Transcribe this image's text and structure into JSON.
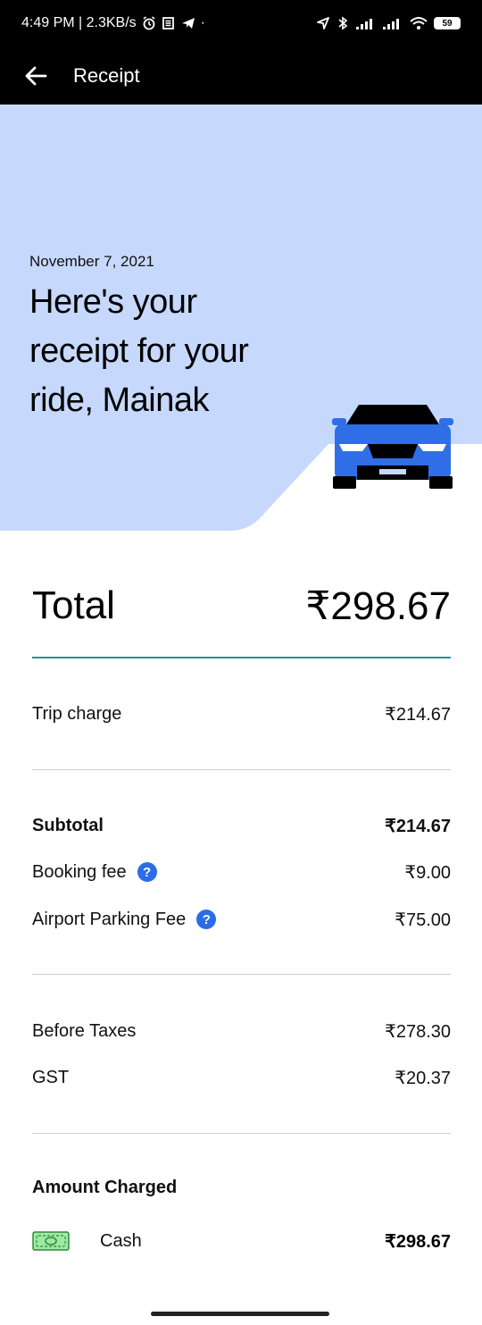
{
  "statusbar": {
    "time_info": "4:49 PM | 2.3KB/s",
    "battery": "59"
  },
  "appbar": {
    "title": "Receipt"
  },
  "hero": {
    "date": "November 7, 2021",
    "headline": "Here's your receipt for your ride, Mainak"
  },
  "total": {
    "label": "Total",
    "value": "₹298.67"
  },
  "trip": {
    "label": "Trip charge",
    "value": "₹214.67"
  },
  "subtotal": {
    "label": "Subtotal",
    "value": "₹214.67"
  },
  "booking": {
    "label": "Booking fee",
    "value": "₹9.00"
  },
  "parking": {
    "label": "Airport Parking Fee",
    "value": "₹75.00"
  },
  "before_taxes": {
    "label": "Before Taxes",
    "value": "₹278.30"
  },
  "gst": {
    "label": "GST",
    "value": "₹20.37"
  },
  "payment": {
    "title": "Amount Charged",
    "method": "Cash",
    "amount": "₹298.67"
  },
  "colors": {
    "hero_bg": "#c6d9fd",
    "car_body": "#2f6ee6",
    "accent_rule": "#2a8f9e",
    "help_icon": "#2b6de8"
  }
}
